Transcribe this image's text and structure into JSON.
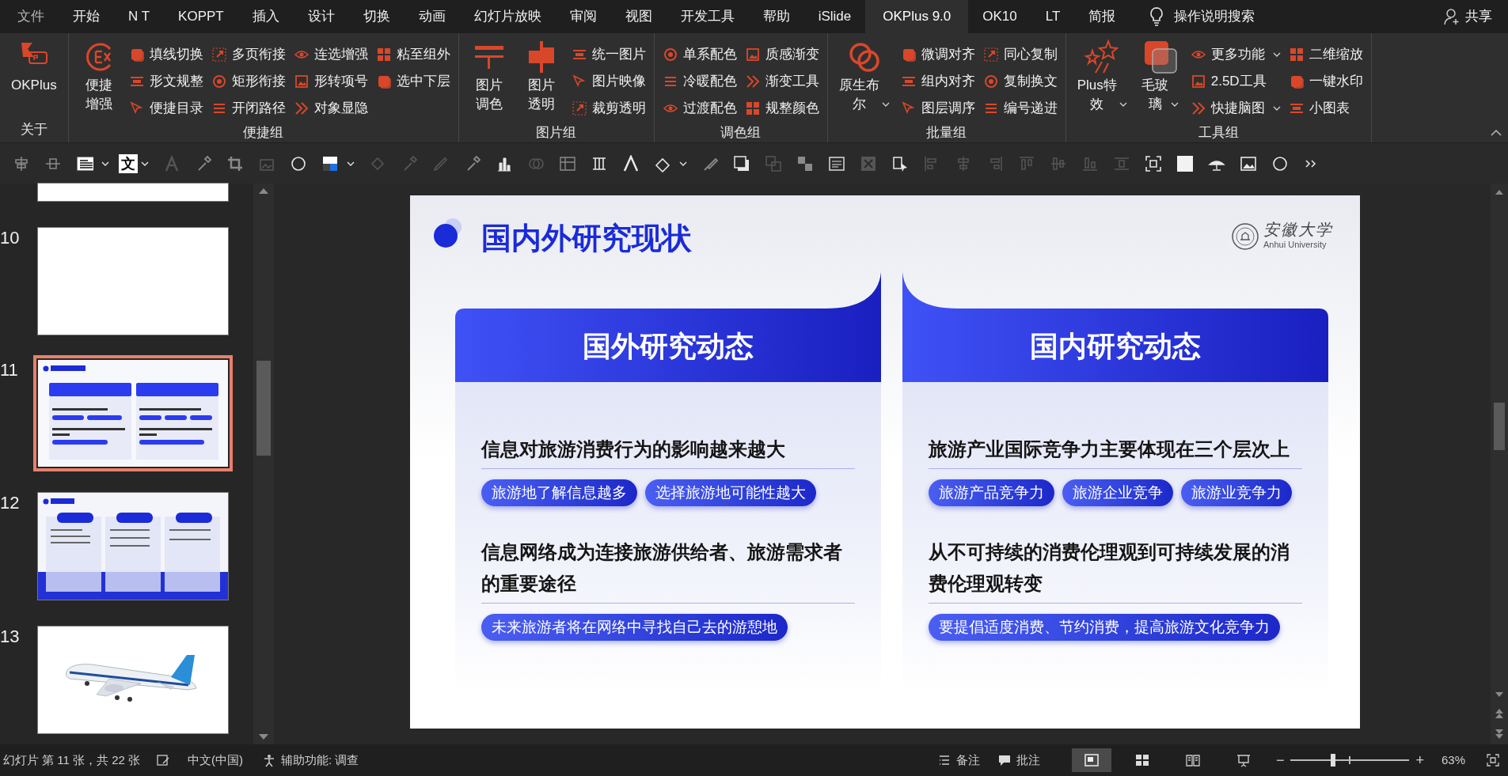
{
  "menu_tabs": [
    {
      "label": "文件",
      "selected": false
    },
    {
      "label": "开始",
      "selected": false
    },
    {
      "label": "N T",
      "selected": false
    },
    {
      "label": "KOPPT",
      "selected": false
    },
    {
      "label": "插入",
      "selected": false
    },
    {
      "label": "设计",
      "selected": false
    },
    {
      "label": "切换",
      "selected": false
    },
    {
      "label": "动画",
      "selected": false
    },
    {
      "label": "幻灯片放映",
      "selected": false
    },
    {
      "label": "审阅",
      "selected": false
    },
    {
      "label": "视图",
      "selected": false
    },
    {
      "label": "开发工具",
      "selected": false
    },
    {
      "label": "帮助",
      "selected": false
    },
    {
      "label": "iSlide",
      "selected": false
    },
    {
      "label": "OKPlus 9.0",
      "selected": true
    },
    {
      "label": "OK10",
      "selected": false
    },
    {
      "label": "LT",
      "selected": false
    },
    {
      "label": "简报",
      "selected": false
    }
  ],
  "tell_me": "操作说明搜索",
  "share": "共享",
  "ribbon_groups": [
    {
      "label": "关于",
      "large": [
        {
          "lines": [
            "OKPlus"
          ],
          "dropdown": false
        }
      ]
    },
    {
      "label": "便捷组",
      "large": [
        {
          "lines": [
            "便捷",
            "增强"
          ],
          "dropdown": false
        }
      ],
      "columns": [
        [
          {
            "label": "填线切换",
            "dropdown": false
          },
          {
            "label": "形文规整",
            "dropdown": false
          },
          {
            "label": "便捷目录",
            "dropdown": false
          }
        ],
        [
          {
            "label": "多页衔接",
            "dropdown": false
          },
          {
            "label": "矩形衔接",
            "dropdown": false
          },
          {
            "label": "开闭路径",
            "dropdown": false
          }
        ],
        [
          {
            "label": "连选增强",
            "dropdown": false
          },
          {
            "label": "形转项号",
            "dropdown": false
          },
          {
            "label": "对象显隐",
            "dropdown": false
          }
        ],
        [
          {
            "label": "粘至组外",
            "dropdown": false
          },
          {
            "label": "选中下层",
            "dropdown": false
          }
        ]
      ]
    },
    {
      "label": "图片组",
      "large": [
        {
          "lines": [
            "图片",
            "调色"
          ],
          "dropdown": false
        },
        {
          "lines": [
            "图片",
            "透明"
          ],
          "dropdown": false
        }
      ],
      "columns": [
        [
          {
            "label": "统一图片",
            "dropdown": false
          },
          {
            "label": "图片映像",
            "dropdown": false
          },
          {
            "label": "裁剪透明",
            "dropdown": false
          }
        ]
      ]
    },
    {
      "label": "调色组",
      "columns": [
        [
          {
            "label": "单系配色",
            "dropdown": false
          },
          {
            "label": "冷暖配色",
            "dropdown": false
          },
          {
            "label": "过渡配色",
            "dropdown": false
          }
        ],
        [
          {
            "label": "质感渐变",
            "dropdown": false
          },
          {
            "label": "渐变工具",
            "dropdown": false
          },
          {
            "label": "规整颜色",
            "dropdown": false
          }
        ]
      ]
    },
    {
      "label": "批量组",
      "large": [
        {
          "lines": [
            "原生布",
            "尔"
          ],
          "dropdown": true
        }
      ],
      "columns": [
        [
          {
            "label": "微调对齐",
            "dropdown": false
          },
          {
            "label": "组内对齐",
            "dropdown": false
          },
          {
            "label": "图层调序",
            "dropdown": false
          }
        ],
        [
          {
            "label": "同心复制",
            "dropdown": false
          },
          {
            "label": "复制换文",
            "dropdown": false
          },
          {
            "label": "编号递进",
            "dropdown": false
          }
        ]
      ]
    },
    {
      "label": "工具组",
      "large": [
        {
          "lines": [
            "Plus特",
            "效"
          ],
          "dropdown": true
        },
        {
          "lines": [
            "毛玻",
            "璃"
          ],
          "dropdown": true
        }
      ],
      "columns": [
        [
          {
            "label": "更多功能",
            "dropdown": true
          },
          {
            "label": "2.5D工具",
            "dropdown": false
          },
          {
            "label": "快捷脑图",
            "dropdown": true
          }
        ],
        [
          {
            "label": "二维缩放",
            "dropdown": false
          },
          {
            "label": "一键水印",
            "dropdown": false
          },
          {
            "label": "小图表",
            "dropdown": false
          }
        ]
      ]
    }
  ],
  "quick_toolbar": {
    "text_glyph": "文"
  },
  "thumbnails": [
    {
      "kind": "blank",
      "selected": false
    },
    {
      "number": "10",
      "kind": "blank",
      "selected": false
    },
    {
      "number": "11",
      "kind": "research",
      "selected": true
    },
    {
      "number": "12",
      "kind": "methods",
      "selected": false
    },
    {
      "number": "13",
      "kind": "picture",
      "selected": false
    }
  ],
  "slide": {
    "title": "国内外研究现状",
    "logo": {
      "name_cn": "安徽大学",
      "name_en": "Anhui University"
    },
    "cards": [
      {
        "header": "国外研究动态",
        "sections": [
          {
            "heading": "信息对旅游消费行为的影响越来越大",
            "pills": [
              "旅游地了解信息越多",
              "选择旅游地可能性越大"
            ]
          },
          {
            "heading": "信息网络成为连接旅游供给者、旅游需求者的重要途径",
            "pills": [
              "未来旅游者将在网络中寻找自己去的游憩地"
            ]
          }
        ]
      },
      {
        "header": "国内研究动态",
        "sections": [
          {
            "heading": "旅游产业国际竞争力主要体现在三个层次上",
            "pills": [
              "旅游产品竞争力",
              "旅游企业竞争",
              "旅游业竞争力"
            ]
          },
          {
            "heading": "从不可持续的消费伦理观到可持续发展的消费伦理观转变",
            "pills": [
              "要提倡适度消费、节约消费，提高旅游文化竞争力"
            ]
          }
        ]
      }
    ]
  },
  "status_bar": {
    "slide_info": "幻灯片 第 11 张，共 22 张",
    "language": "中文(中国)",
    "accessibility": "辅助功能: 调查",
    "notes": "备注",
    "comments": "批注",
    "views": [
      {
        "selected": true
      },
      {
        "selected": false
      },
      {
        "selected": false
      },
      {
        "selected": false
      }
    ],
    "zoom_out": "−",
    "zoom_in": "+",
    "zoom": {
      "level": 0.36
    },
    "zoom_reading": "63%"
  }
}
